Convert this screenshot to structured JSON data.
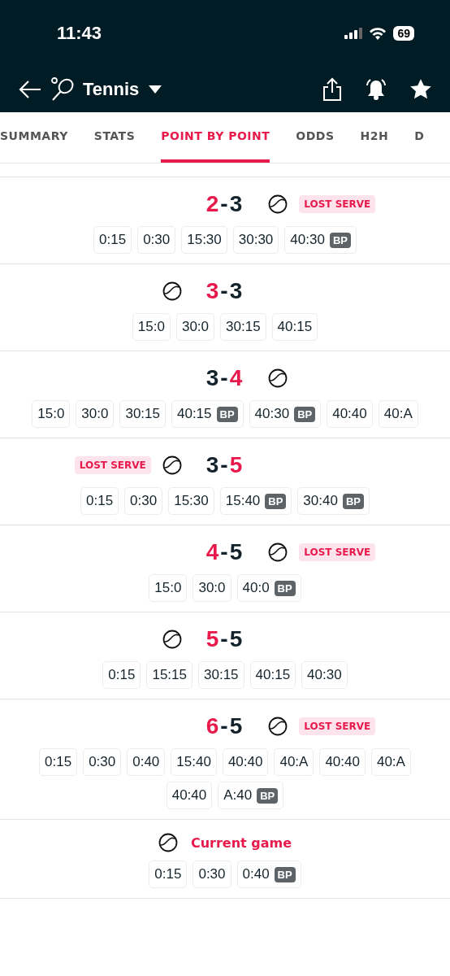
{
  "status_bar": {
    "time": "11:43",
    "battery": "69"
  },
  "header": {
    "title": "Tennis"
  },
  "tabs": [
    {
      "label": "SUMMARY",
      "selected": false
    },
    {
      "label": "STATS",
      "selected": false
    },
    {
      "label": "POINT BY POINT",
      "selected": true
    },
    {
      "label": "ODDS",
      "selected": false
    },
    {
      "label": "H2H",
      "selected": false
    },
    {
      "label": "D",
      "selected": false
    }
  ],
  "games": [
    {
      "kind": "game",
      "home": "2",
      "dash": "-",
      "away": "3",
      "home_highlighted": true,
      "home_serving": false,
      "lost_serve": "LOST SERVE",
      "points": [
        {
          "score": "0:15",
          "bp": false
        },
        {
          "score": "0:30",
          "bp": false
        },
        {
          "score": "15:30",
          "bp": false
        },
        {
          "score": "30:30",
          "bp": false
        },
        {
          "score": "40:30",
          "bp": true,
          "bp_label": "BP"
        }
      ]
    },
    {
      "kind": "game",
      "home": "3",
      "dash": "-",
      "away": "3",
      "home_highlighted": true,
      "home_serving": true,
      "points": [
        {
          "score": "15:0",
          "bp": false
        },
        {
          "score": "30:0",
          "bp": false
        },
        {
          "score": "30:15",
          "bp": false
        },
        {
          "score": "40:15",
          "bp": false
        }
      ]
    },
    {
      "kind": "game",
      "home": "3",
      "dash": "-",
      "away": "4",
      "home_highlighted": false,
      "home_serving": false,
      "points": [
        {
          "score": "15:0",
          "bp": false
        },
        {
          "score": "30:0",
          "bp": false
        },
        {
          "score": "30:15",
          "bp": false
        },
        {
          "score": "40:15",
          "bp": true,
          "bp_label": "BP"
        },
        {
          "score": "40:30",
          "bp": true,
          "bp_label": "BP"
        },
        {
          "score": "40:40",
          "bp": false
        },
        {
          "score": "40:A",
          "bp": false
        }
      ]
    },
    {
      "kind": "game",
      "home": "3",
      "dash": "-",
      "away": "5",
      "home_highlighted": false,
      "home_serving": true,
      "lost_serve": "LOST SERVE",
      "points": [
        {
          "score": "0:15",
          "bp": false
        },
        {
          "score": "0:30",
          "bp": false
        },
        {
          "score": "15:30",
          "bp": false
        },
        {
          "score": "15:40",
          "bp": true,
          "bp_label": "BP"
        },
        {
          "score": "30:40",
          "bp": true,
          "bp_label": "BP"
        }
      ]
    },
    {
      "kind": "game",
      "home": "4",
      "dash": "-",
      "away": "5",
      "home_highlighted": true,
      "home_serving": false,
      "lost_serve": "LOST SERVE",
      "points": [
        {
          "score": "15:0",
          "bp": false
        },
        {
          "score": "30:0",
          "bp": false
        },
        {
          "score": "40:0",
          "bp": true,
          "bp_label": "BP"
        }
      ]
    },
    {
      "kind": "game",
      "home": "5",
      "dash": "-",
      "away": "5",
      "home_highlighted": true,
      "home_serving": true,
      "points": [
        {
          "score": "0:15",
          "bp": false
        },
        {
          "score": "15:15",
          "bp": false
        },
        {
          "score": "30:15",
          "bp": false
        },
        {
          "score": "40:15",
          "bp": false
        },
        {
          "score": "40:30",
          "bp": false
        }
      ]
    },
    {
      "kind": "game",
      "home": "6",
      "dash": "-",
      "away": "5",
      "home_highlighted": true,
      "home_serving": false,
      "lost_serve": "LOST SERVE",
      "points": [
        {
          "score": "0:15",
          "bp": false
        },
        {
          "score": "0:30",
          "bp": false
        },
        {
          "score": "0:40",
          "bp": false
        },
        {
          "score": "15:40",
          "bp": false
        },
        {
          "score": "40:40",
          "bp": false
        },
        {
          "score": "40:A",
          "bp": false
        },
        {
          "score": "40:40",
          "bp": false
        },
        {
          "score": "40:A",
          "bp": false
        },
        {
          "score": "40:40",
          "bp": false
        },
        {
          "score": "A:40",
          "bp": true,
          "bp_label": "BP"
        }
      ]
    },
    {
      "kind": "current",
      "label": "Current game",
      "points": [
        {
          "score": "0:15",
          "bp": false
        },
        {
          "score": "0:30",
          "bp": false
        },
        {
          "score": "0:40",
          "bp": true,
          "bp_label": "BP"
        }
      ]
    }
  ]
}
